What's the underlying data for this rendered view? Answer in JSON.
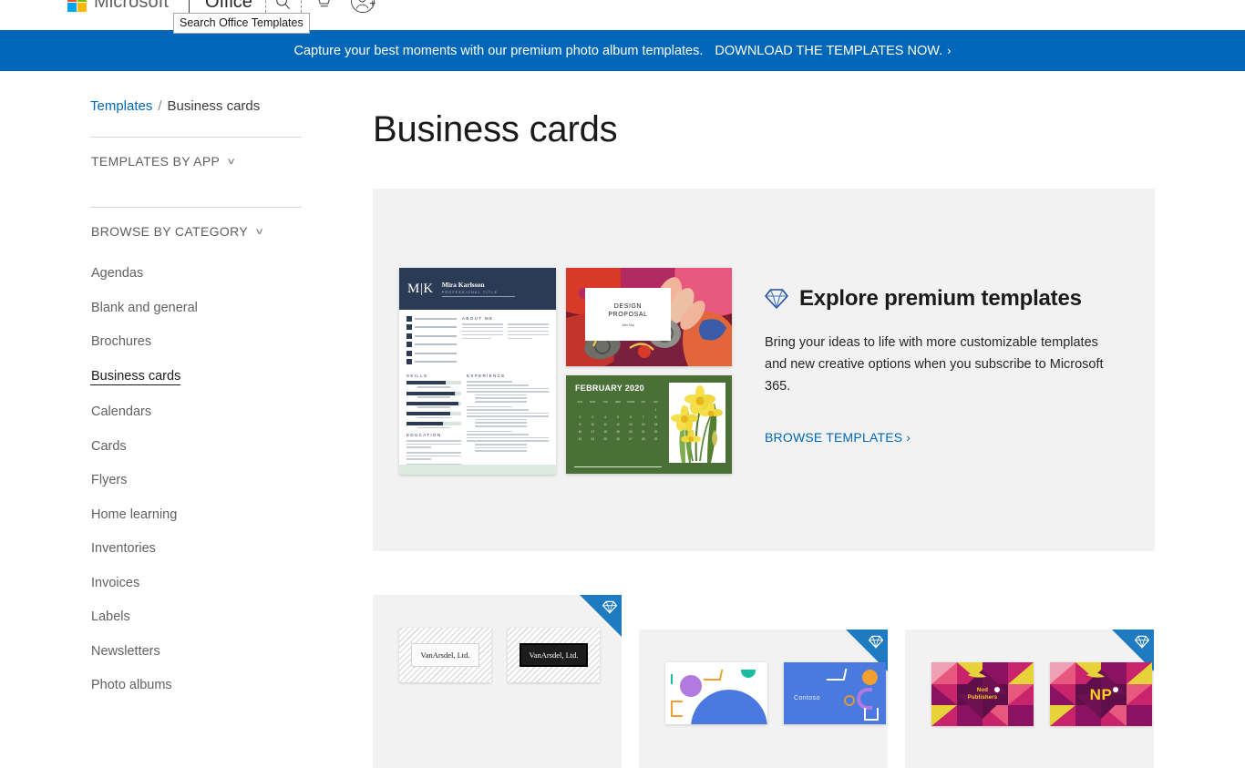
{
  "header": {
    "brand": "Microsoft",
    "product": "Office",
    "search_tooltip": "Search Office Templates",
    "icons": {
      "search": "search-icon",
      "cart": "shopping-cart-icon",
      "account": "person-add-icon"
    }
  },
  "banner": {
    "message": "Capture your best moments with our premium photo album templates.",
    "cta": "DOWNLOAD THE TEMPLATES NOW.",
    "chevron": "›",
    "background": "#0067b8"
  },
  "breadcrumb": {
    "root": "Templates",
    "separator": "/",
    "current": "Business cards"
  },
  "sidebar": {
    "sections": [
      {
        "label": "TEMPLATES BY APP",
        "caret": "∨"
      },
      {
        "label": "BROWSE BY CATEGORY",
        "caret": "∨"
      }
    ],
    "categories": [
      {
        "label": "Agendas",
        "active": false
      },
      {
        "label": "Blank and general",
        "active": false
      },
      {
        "label": "Brochures",
        "active": false
      },
      {
        "label": "Business cards",
        "active": true
      },
      {
        "label": "Calendars",
        "active": false
      },
      {
        "label": "Cards",
        "active": false
      },
      {
        "label": "Flyers",
        "active": false
      },
      {
        "label": "Home learning",
        "active": false
      },
      {
        "label": "Inventories",
        "active": false
      },
      {
        "label": "Invoices",
        "active": false
      },
      {
        "label": "Labels",
        "active": false
      },
      {
        "label": "Newsletters",
        "active": false
      },
      {
        "label": "Photo albums",
        "active": false
      }
    ]
  },
  "main": {
    "title": "Business cards",
    "premium": {
      "heading": "Explore premium templates",
      "body": "Bring your ideas to life with more customizable templates and new creative options when you subscribe to Microsoft 365.",
      "link": "BROWSE TEMPLATES",
      "chevron": "›",
      "accent": "#0067b8",
      "background": "#f2f2f2",
      "thumbnails": [
        {
          "name": "resume-thumbnail",
          "initials": "M|K",
          "person": "Mira Karlsson",
          "subtitle": "PROFESSIONAL TITLE",
          "headings": [
            "ABOUT ME",
            "SKILLS",
            "EXPERIENCE",
            "EDUCATION"
          ]
        },
        {
          "name": "design-proposal-thumbnail",
          "title_line1": "DESIGN",
          "title_line2": "PROPOSAL",
          "author": "Alex Maj"
        },
        {
          "name": "calendar-thumbnail",
          "title": "FEBRUARY 2020",
          "day_labels": [
            "SUN",
            "MON",
            "TUE",
            "WED",
            "THURS",
            "FRI",
            "SAT"
          ],
          "dates": [
            "",
            "",
            "",
            "",
            "",
            "",
            "1",
            "2",
            "3",
            "4",
            "5",
            "6",
            "7",
            "8",
            "9",
            "10",
            "11",
            "12",
            "13",
            "14",
            "15",
            "16",
            "17",
            "18",
            "19",
            "20",
            "21",
            "22",
            "23",
            "24",
            "25",
            "26",
            "27",
            "28",
            "29"
          ]
        }
      ]
    },
    "results": [
      {
        "name": "vanarsdel-business-card",
        "premium": true,
        "badge_icon": "diamond-icon",
        "cards": [
          {
            "label": "VanArsdel, Ltd.",
            "style": "light"
          },
          {
            "label": "VanArsdel, Ltd.",
            "style": "dark"
          }
        ]
      },
      {
        "name": "contoso-business-card",
        "premium": true,
        "badge_icon": "diamond-icon",
        "cards": [
          {
            "label": "",
            "style": "geometric-white"
          },
          {
            "label": "Contoso",
            "style": "geometric-blue"
          }
        ]
      },
      {
        "name": "nod-publishers-business-card",
        "premium": true,
        "badge_icon": "diamond-icon",
        "cards": [
          {
            "label_line1": "Nod",
            "label_line2": "Publishers",
            "style": "geometric-magenta"
          },
          {
            "label": "NP",
            "style": "geometric-magenta-monogram"
          }
        ]
      }
    ]
  }
}
